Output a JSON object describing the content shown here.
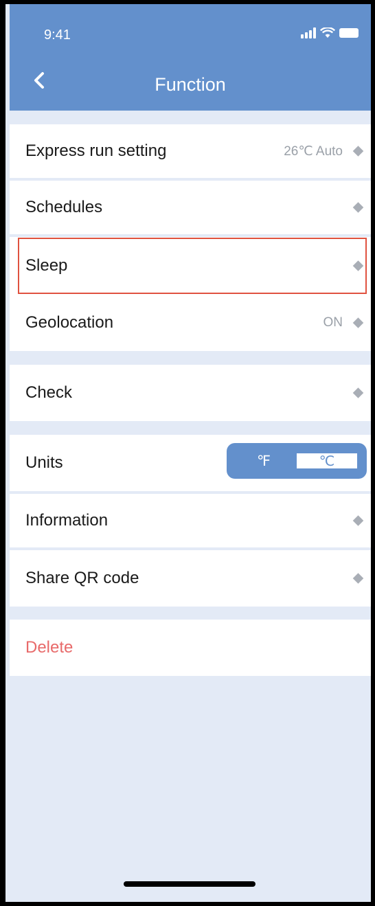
{
  "status_bar": {
    "time": "9:41"
  },
  "header": {
    "title": "Function"
  },
  "rows": {
    "express": {
      "label": "Express run setting",
      "value": "26℃ Auto"
    },
    "schedules": {
      "label": "Schedules"
    },
    "sleep": {
      "label": "Sleep"
    },
    "geolocation": {
      "label": "Geolocation",
      "value": "ON"
    },
    "check": {
      "label": "Check"
    },
    "units": {
      "label": "Units",
      "option_f": "℉",
      "option_c": "℃",
      "selected": "℃"
    },
    "information": {
      "label": "Information"
    },
    "share": {
      "label": "Share QR code"
    },
    "delete": {
      "label": "Delete"
    }
  },
  "colors": {
    "header": "#6390cc",
    "background": "#e3eaf6",
    "highlight": "#e0523f",
    "delete": "#e86a6a"
  },
  "icons": [
    "signal-icon",
    "wifi-icon",
    "battery-icon",
    "back-chevron-icon",
    "diamond-icon"
  ]
}
